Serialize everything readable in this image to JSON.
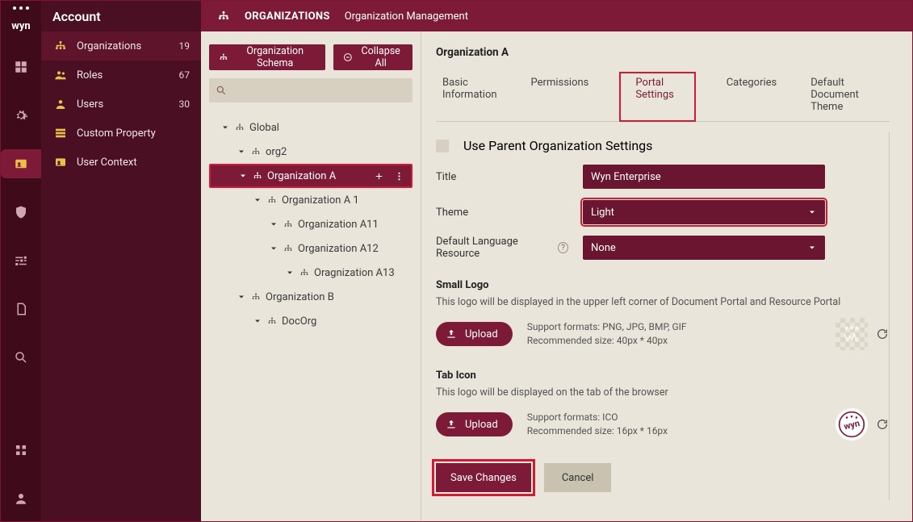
{
  "brand": "wyn",
  "sidebar": {
    "title": "Account",
    "items": [
      {
        "label": "Organizations",
        "count": "19",
        "icon": "org"
      },
      {
        "label": "Roles",
        "count": "67",
        "icon": "roles"
      },
      {
        "label": "Users",
        "count": "30",
        "icon": "user"
      },
      {
        "label": "Custom Property",
        "count": "",
        "icon": "prop"
      },
      {
        "label": "User Context",
        "count": "",
        "icon": "context"
      }
    ]
  },
  "topbar": {
    "title": "ORGANIZATIONS",
    "subtitle": "Organization Management"
  },
  "toolbar": {
    "schema": "Organization Schema",
    "collapse": "Collapse All"
  },
  "search": {
    "placeholder": ""
  },
  "tree": [
    {
      "label": "Global",
      "depth": 0
    },
    {
      "label": "org2",
      "depth": 1
    },
    {
      "label": "Organization A",
      "depth": 1,
      "selected": true
    },
    {
      "label": "Organization A 1",
      "depth": 2
    },
    {
      "label": "Organization A11",
      "depth": 3
    },
    {
      "label": "Organization A12",
      "depth": 3
    },
    {
      "label": "Oragnization A13",
      "depth": 4
    },
    {
      "label": "Organization B",
      "depth": 1
    },
    {
      "label": "DocOrg",
      "depth": 2
    }
  ],
  "detail": {
    "heading": "Organization A",
    "tabs": [
      "Basic Information",
      "Permissions",
      "Portal Settings",
      "Categories",
      "Default Document Theme"
    ],
    "useParent": "Use Parent Organization Settings",
    "fields": {
      "title": {
        "label": "Title",
        "value": "Wyn Enterprise"
      },
      "theme": {
        "label": "Theme",
        "value": "Light"
      },
      "lang": {
        "label": "Default Language Resource",
        "value": "None"
      }
    },
    "smallLogo": {
      "heading": "Small Logo",
      "desc": "This logo will be displayed in the upper left corner of Document Portal and Resource Portal",
      "upload": "Upload",
      "meta1": "Support formats: PNG, JPG, BMP, GIF",
      "meta2": "Recommended size: 40px * 40px"
    },
    "tabIcon": {
      "heading": "Tab Icon",
      "desc": "This logo will be displayed on the tab of the browser",
      "upload": "Upload",
      "meta1": "Support formats: ICO",
      "meta2": "Recommended size: 16px * 16px"
    },
    "save": "Save Changes",
    "cancel": "Cancel"
  }
}
